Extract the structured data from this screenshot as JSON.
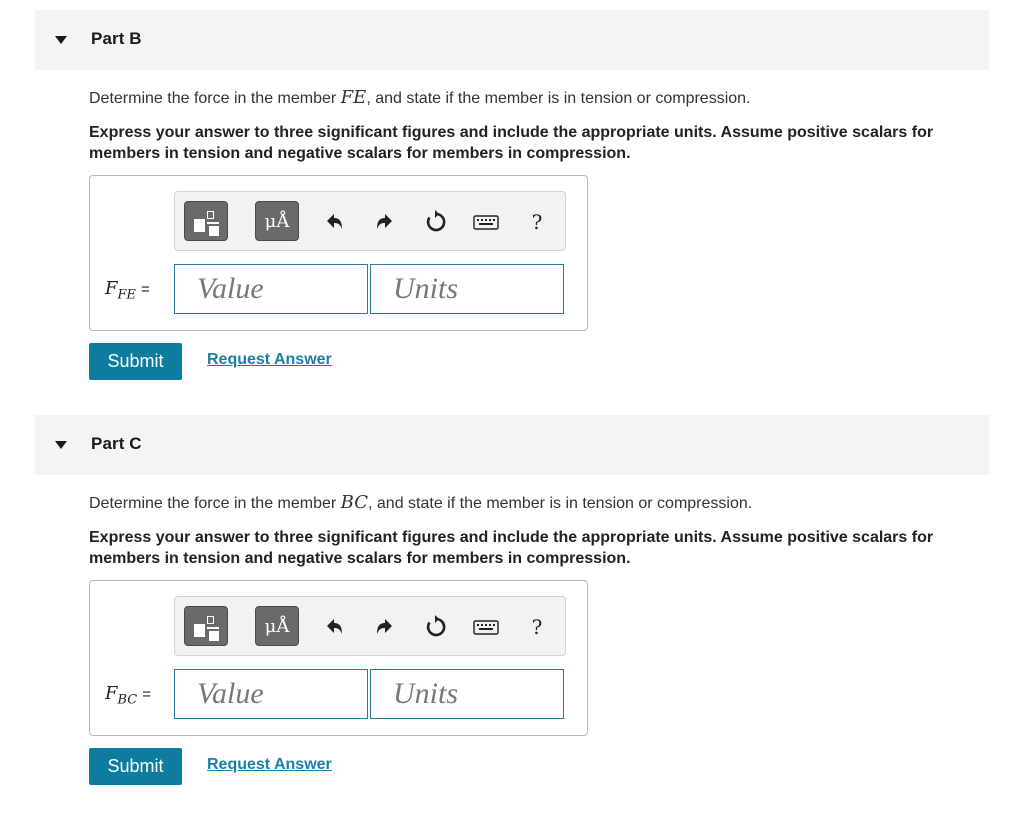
{
  "parts": [
    {
      "title": "Part B",
      "question_prefix": "Determine the force in the member ",
      "member": "FE",
      "question_suffix": ", and state if the member is in tension or compression.",
      "instruction": "Express your answer to three significant figures and include the appropriate units. Assume positive scalars for members in tension and negative scalars for members in compression.",
      "variable_main": "F",
      "variable_sub": "FE",
      "equals": "=",
      "value_placeholder": "Value",
      "units_placeholder": "Units",
      "units_button": "μÅ",
      "help": "?",
      "submit": "Submit",
      "request_answer": "Request Answer"
    },
    {
      "title": "Part C",
      "question_prefix": "Determine the force in the member ",
      "member": "BC",
      "question_suffix": ", and state if the member is in tension or compression.",
      "instruction": "Express your answer to three significant figures and include the appropriate units. Assume positive scalars for members in tension and negative scalars for members in compression.",
      "variable_main": "F",
      "variable_sub": "BC",
      "equals": "=",
      "value_placeholder": "Value",
      "units_placeholder": "Units",
      "units_button": "μÅ",
      "help": "?",
      "submit": "Submit",
      "request_answer": "Request Answer"
    }
  ],
  "icons": [
    "caret-down-icon",
    "template-icon",
    "undo-icon",
    "redo-icon",
    "reset-icon",
    "keyboard-icon",
    "help-icon"
  ],
  "colors": {
    "header_bg": "#f4f4f4",
    "submit_bg": "#0e7c9e",
    "link": "#1a7fa6",
    "field_border": "#2a7a9a",
    "toolbar_button": "#6a6a6a"
  }
}
